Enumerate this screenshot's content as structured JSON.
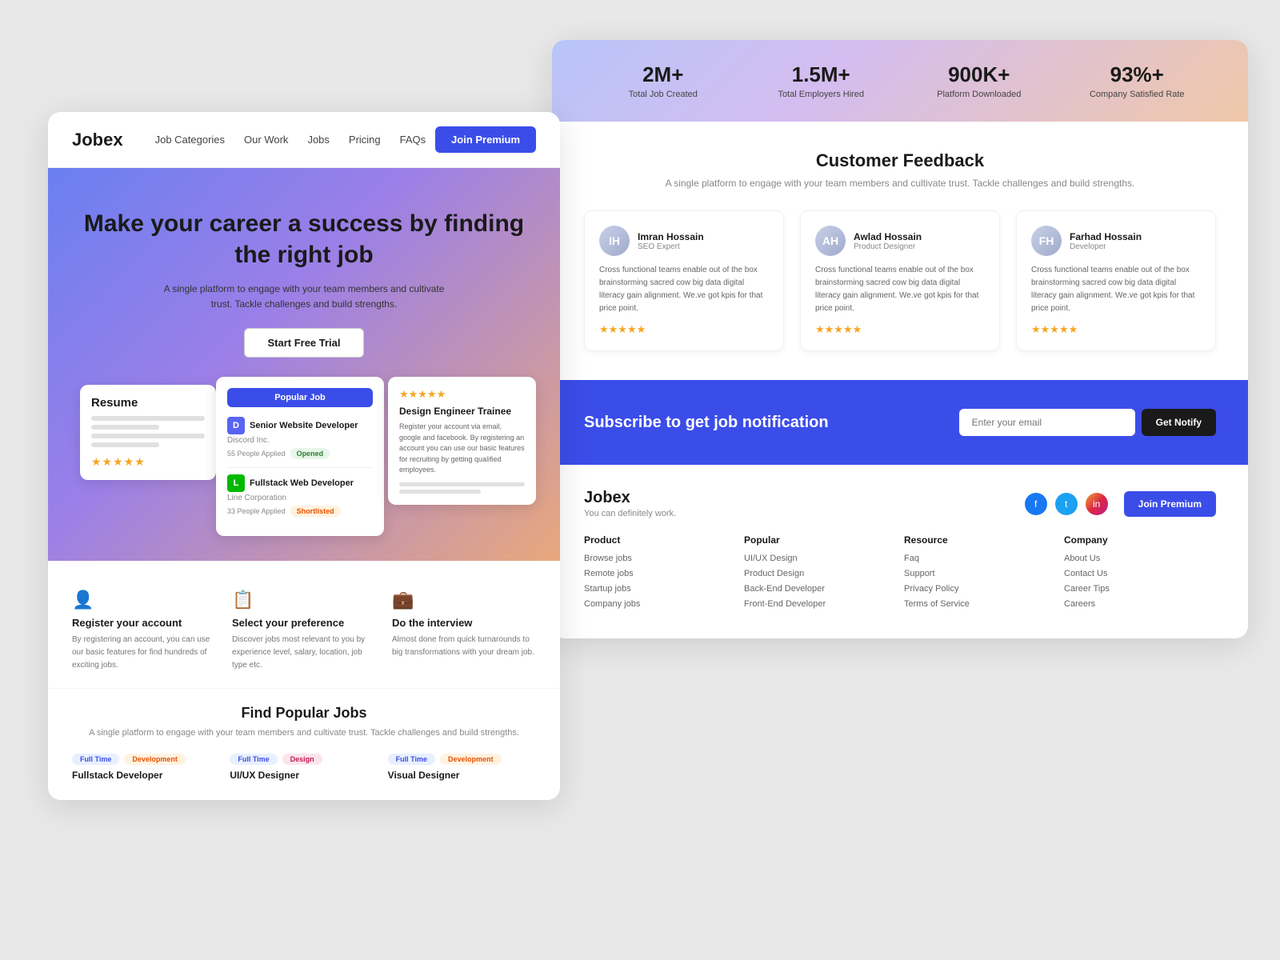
{
  "left": {
    "navbar": {
      "logo": "Jobex",
      "links": [
        "Job Categories",
        "Our Work",
        "Jobs",
        "Pricing",
        "FAQs"
      ],
      "cta": "Join Premium"
    },
    "hero": {
      "title": "Make your career a success by finding the right job",
      "subtitle": "A single platform to engage with your team members and cultivate trust. Tackle challenges and build strengths.",
      "cta": "Start Free Trial"
    },
    "popular_card": {
      "badge": "Popular Job",
      "jobs": [
        {
          "title": "Senior Website Developer",
          "company": "Discord Inc.",
          "icon_type": "discord",
          "icon_label": "D",
          "people": "55 People Applied",
          "badge": "Opened",
          "badge_type": "opened"
        },
        {
          "title": "Fullstack Web Developer",
          "company": "Line Corporation",
          "icon_type": "line",
          "icon_label": "L",
          "people": "33 People Applied",
          "badge": "Shortlisted",
          "badge_type": "shortlisted"
        }
      ]
    },
    "design_card": {
      "stars": "★★★★★",
      "title": "Design Engineer Trainee",
      "text": "Register your account via email, google and facebook. By registering an account you can use our basic features for recruiting by getting qualified employees."
    },
    "resume_card": {
      "title": "Resume",
      "stars": "★★★★★"
    },
    "steps": [
      {
        "icon": "person",
        "title": "Register your account",
        "desc": "By registering an account, you can use our basic features for find hundreds of exciting jobs."
      },
      {
        "icon": "list",
        "title": "Select your preference",
        "desc": "Discover jobs most relevant to you by experience level, salary, location, job type etc."
      },
      {
        "icon": "brief",
        "title": "Do the interview",
        "desc": "Almost done from quick turnarounds to big transformations with your dream job."
      }
    ],
    "jobs_section": {
      "title": "Find Popular Jobs",
      "subtitle": "A single platform to engage with your team members and cultivate trust.\nTackle challenges and build strengths.",
      "jobs": [
        {
          "tag1": "Full Time",
          "tag1_type": "fulltime",
          "tag2": "Development",
          "tag2_type": "dev",
          "name": "Fullstack Developer"
        },
        {
          "tag1": "Full Time",
          "tag1_type": "fulltime",
          "tag2": "Design",
          "tag2_type": "design",
          "name": "UI/UX Designer"
        },
        {
          "tag1": "Full Time",
          "tag1_type": "fulltime",
          "tag2": "Development",
          "tag2_type": "dev",
          "name": "Visual Designer"
        }
      ]
    }
  },
  "right": {
    "stats": [
      {
        "number": "2M+",
        "label": "Total Job Created"
      },
      {
        "number": "1.5M+",
        "label": "Total Employers Hired"
      },
      {
        "number": "900K+",
        "label": "Platform Downloaded"
      },
      {
        "number": "93%+",
        "label": "Company Satisfied Rate"
      }
    ],
    "feedback": {
      "title": "Customer Feedback",
      "subtitle": "A single platform to engage with your team members and cultivate trust.\nTackle challenges and build strengths.",
      "cards": [
        {
          "name": "Imran Hossain",
          "role": "SEO Expert",
          "initials": "IH",
          "text": "Cross functional teams enable out of the box brainstorming sacred cow big data digital literacy gain alignment. We.ve got kpis for that price point.",
          "stars": "★★★★★"
        },
        {
          "name": "Awlad Hossain",
          "role": "Product Designer",
          "initials": "AH",
          "text": "Cross functional teams enable out of the box brainstorming sacred cow big data digital literacy gain alignment. We.ve got kpis for that price point.",
          "stars": "★★★★★"
        },
        {
          "name": "Farhad Hossain",
          "role": "Developer",
          "initials": "FH",
          "text": "Cross functional teams enable out of the box brainstorming sacred cow big data digital literacy gain alignment. We.ve got kpis for that price point.",
          "stars": "★★★★★"
        }
      ]
    },
    "subscribe": {
      "title": "Subscribe to get job notification",
      "placeholder": "Enter your email",
      "btn": "Get Notify"
    },
    "footer": {
      "logo": "Jobex",
      "tagline": "You can definitely work.",
      "join_btn": "Join Premium",
      "cols": [
        {
          "title": "Product",
          "links": [
            "Browse jobs",
            "Remote jobs",
            "Startup jobs",
            "Company jobs"
          ]
        },
        {
          "title": "Popular",
          "links": [
            "UI/UX Design",
            "Product Design",
            "Back-End Developer",
            "Front-End Developer"
          ]
        },
        {
          "title": "Resource",
          "links": [
            "Faq",
            "Support",
            "Privacy Policy",
            "Terms of Service"
          ]
        },
        {
          "title": "Company",
          "links": [
            "About Us",
            "Contact Us",
            "Career Tips",
            "Careers"
          ]
        }
      ]
    }
  }
}
